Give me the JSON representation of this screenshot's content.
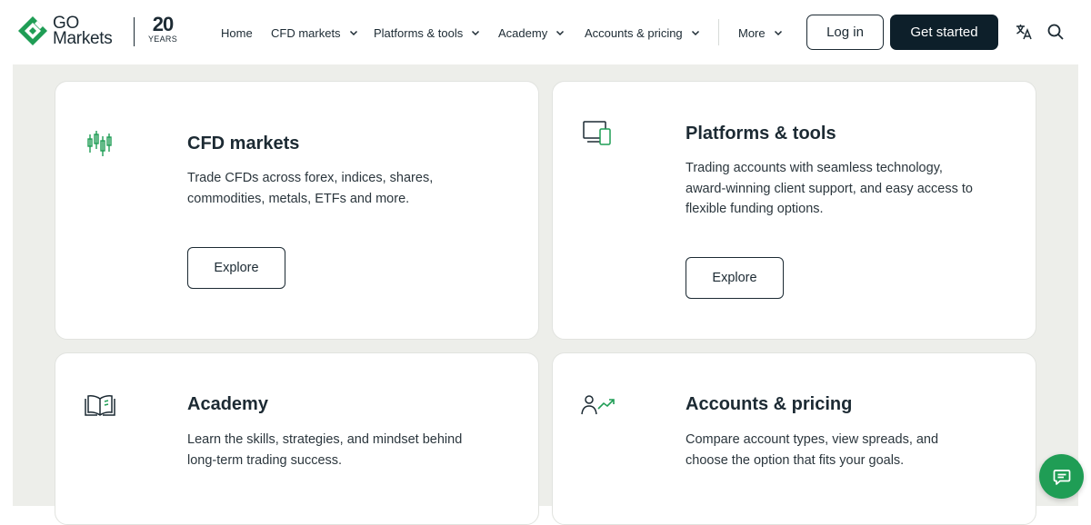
{
  "brand": {
    "logo_line1": "GO",
    "logo_line2": "Markets",
    "anniversary_number": "20",
    "anniversary_label": "YEARS",
    "accent_color": "#1f9d55"
  },
  "nav": {
    "items": [
      {
        "label": "Home",
        "has_dropdown": false
      },
      {
        "label": "CFD markets",
        "has_dropdown": true
      },
      {
        "label": "Platforms & tools",
        "has_dropdown": true
      },
      {
        "label": "Academy",
        "has_dropdown": true
      },
      {
        "label": "Accounts & pricing",
        "has_dropdown": true
      },
      {
        "label": "More",
        "has_dropdown": true
      }
    ],
    "login_label": "Log in",
    "get_started_label": "Get started",
    "icons": [
      "translate-icon",
      "search-icon"
    ]
  },
  "cards": [
    {
      "icon": "candlestick-icon",
      "title": "CFD markets",
      "description_lines": [
        "Trade CFDs across forex, indices, shares,",
        "commodities, metals, ETFs and more."
      ],
      "button_label": "Explore"
    },
    {
      "icon": "devices-icon",
      "title": "Platforms & tools",
      "description_lines": [
        "Trading accounts with seamless technology,",
        "award-winning client support, and easy access to",
        "flexible funding options."
      ],
      "button_label": "Explore"
    },
    {
      "icon": "open-book-icon",
      "title": "Academy",
      "description_lines": [
        "Learn the skills, strategies, and mindset behind",
        "long-term trading success."
      ]
    },
    {
      "icon": "user-growth-icon",
      "title": "Accounts & pricing",
      "description_lines": [
        "Compare account types, view spreads, and",
        "choose the option that fits your goals."
      ]
    }
  ],
  "chat": {
    "icon": "chat-icon"
  }
}
